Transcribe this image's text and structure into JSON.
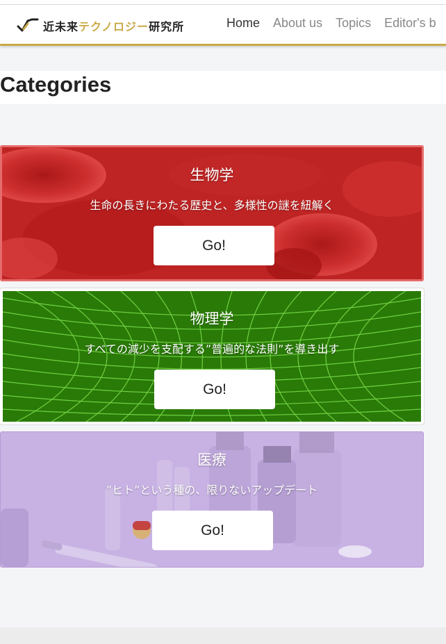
{
  "brand": {
    "name_black": "近未来",
    "name_gold": "テクノロジー",
    "name_black2": "研究所"
  },
  "nav": {
    "items": [
      {
        "label": "Home",
        "active": true
      },
      {
        "label": "About us",
        "active": false
      },
      {
        "label": "Topics",
        "active": false
      },
      {
        "label": "Editor's b",
        "active": false
      }
    ]
  },
  "page": {
    "title": "Categories"
  },
  "categories": [
    {
      "title": "生物学",
      "description": "生命の長きにわたる歴史と、多様性の謎を紐解く",
      "button_label": "Go!",
      "theme_color": "#c62828"
    },
    {
      "title": "物理学",
      "description": "すべての減少を支配する”普遍的な法則”を導き出す",
      "button_label": "Go!",
      "theme_color": "#2e7d0a"
    },
    {
      "title": "医療",
      "description": "”ヒト”という種の、限りないアップデート",
      "button_label": "Go!",
      "theme_color": "#c8b2e4"
    }
  ],
  "colors": {
    "accent_gold": "#c9a947",
    "text_dark": "#222222",
    "nav_inactive": "#888888"
  }
}
